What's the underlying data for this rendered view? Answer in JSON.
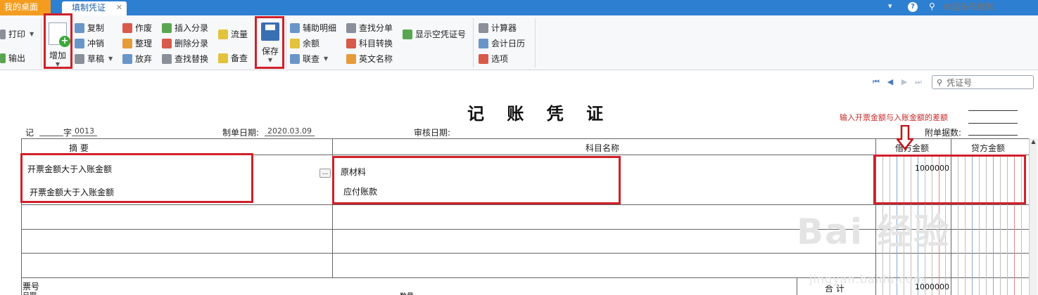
{
  "tabs": {
    "home": "我的桌面",
    "active": "填制凭证",
    "close": "✕"
  },
  "topbar": {
    "dropdown": "▾",
    "help": "?",
    "search_placeholder": "单据条码搜索"
  },
  "toolbar": {
    "print": "打印",
    "export": "输出",
    "add": "增加",
    "copy": "复制",
    "reverse": "冲销",
    "draft": "草稿",
    "void": "作废",
    "tidy": "整理",
    "discard": "放弃",
    "insert_entry": "插入分录",
    "delete_entry": "删除分录",
    "find_replace": "查找替换",
    "flow": "流量",
    "remark": "备查",
    "save": "保存",
    "aux_detail": "辅助明细",
    "balance": "余额",
    "link_query": "联查",
    "find_entry": "查找分单",
    "account_convert": "科目转换",
    "english_name": "英文名称",
    "show_vacant": "显示空凭证号",
    "calculator": "计算器",
    "calendar": "会计日历",
    "options": "选项"
  },
  "voucher": {
    "search_placeholder": "凭证号",
    "title": "记 账 凭 证",
    "hint": "输入开票金额与入账金额的差额",
    "type_label": "记",
    "num_label": "字",
    "num_value": "0013",
    "date_label": "制单日期:",
    "date_value": "2020.03.09",
    "audit_label": "审核日期:",
    "attach_label": "附单据数:",
    "col_summary": "摘 要",
    "col_account": "科目名称",
    "col_debit": "借方金额",
    "col_credit": "贷方金额",
    "rows": [
      {
        "summary": "开票金额大于入账金额",
        "account": "原材料",
        "debit": "1000000"
      },
      {
        "summary": "开票金额大于入账金额",
        "account": "应付账款",
        "debit": ""
      }
    ],
    "ticket_label": "票号",
    "date_footer": "日期",
    "qty_label": "数量",
    "total_label": "合 计",
    "total_debit": "1000000",
    "more_button": "...",
    "scroll_up": "▲"
  },
  "watermark": {
    "brand": "Bai 经验",
    "url": "jingyan.baidu.com"
  }
}
